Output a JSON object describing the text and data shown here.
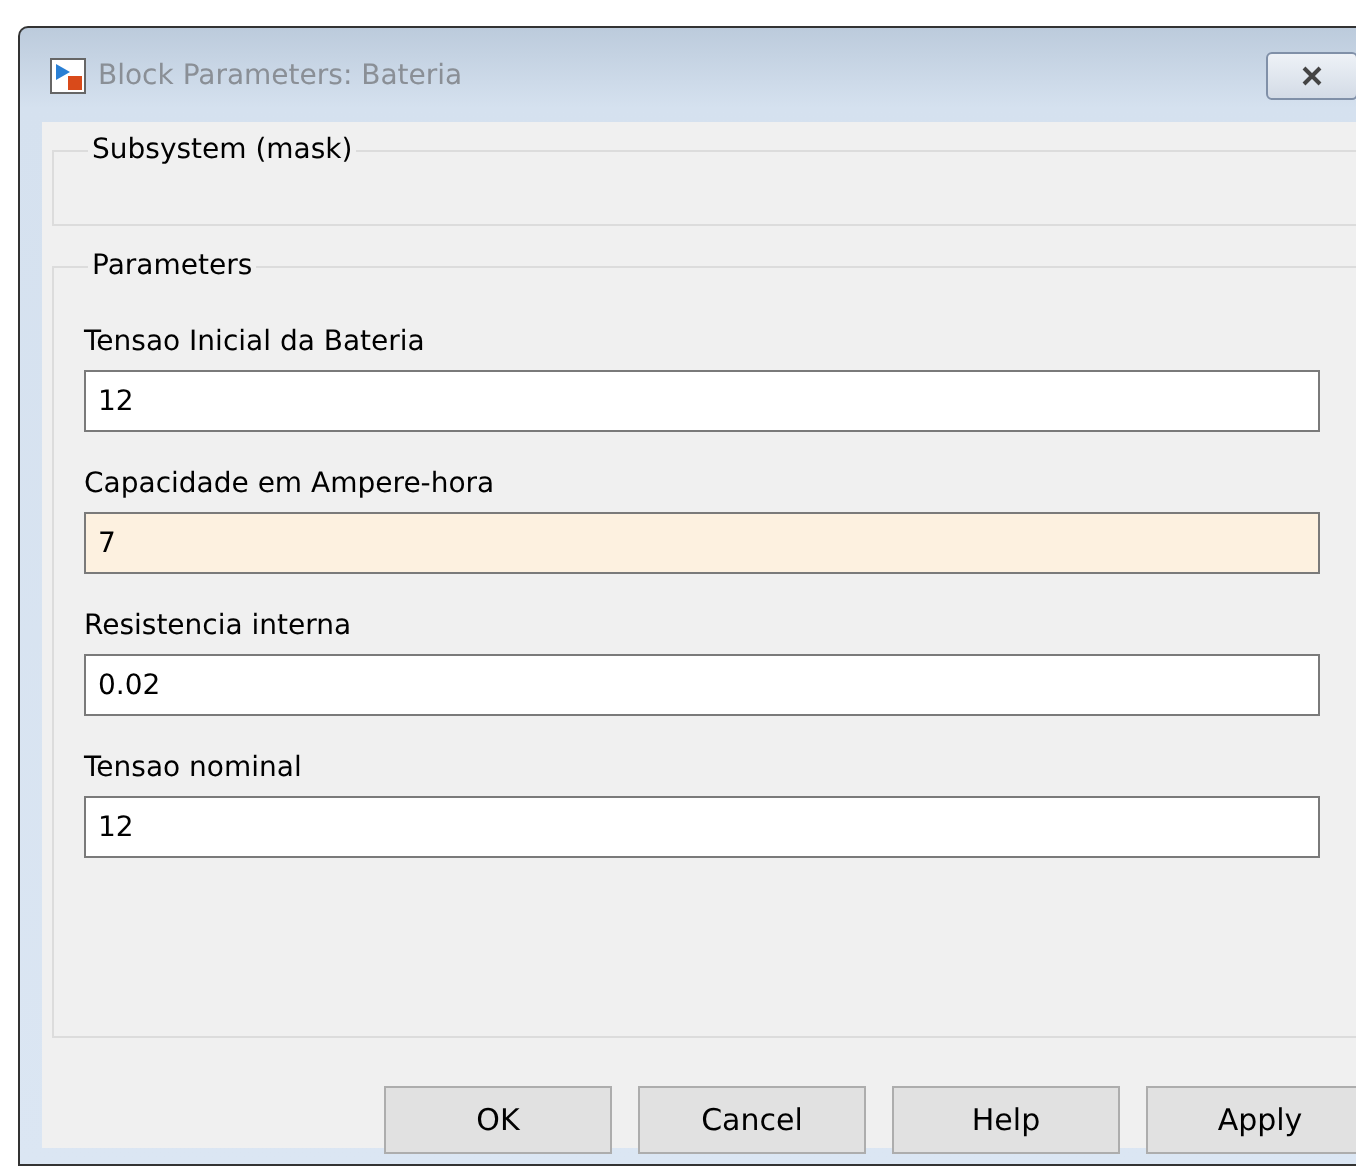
{
  "window": {
    "title": "Block Parameters: Bateria"
  },
  "mask_group": {
    "title": "Subsystem (mask)"
  },
  "parameters": {
    "title": "Parameters",
    "fields": [
      {
        "label": "Tensao Inicial da Bateria",
        "value": "12",
        "focused": false
      },
      {
        "label": "Capacidade em Ampere-hora",
        "value": "7",
        "focused": true
      },
      {
        "label": "Resistencia interna",
        "value": "0.02",
        "focused": false
      },
      {
        "label": "Tensao nominal",
        "value": "12",
        "focused": false
      }
    ]
  },
  "buttons": [
    "OK",
    "Cancel",
    "Help",
    "Apply"
  ]
}
